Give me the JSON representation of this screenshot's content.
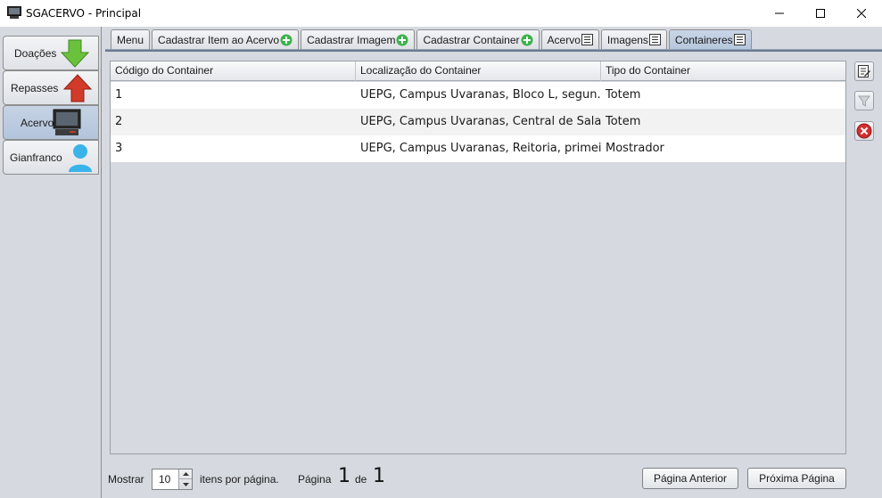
{
  "window": {
    "title": "SGACERVO - Principal"
  },
  "sidebar": {
    "items": [
      {
        "label": "Doações",
        "icon": "arrow-down-green-icon"
      },
      {
        "label": "Repasses",
        "icon": "arrow-up-red-icon"
      },
      {
        "label": "Acervo",
        "icon": "computer-icon",
        "selected": true
      },
      {
        "label": "Gianfranco",
        "icon": "user-icon"
      }
    ]
  },
  "tabs": [
    {
      "label": "Menu",
      "icon": ""
    },
    {
      "label": "Cadastrar Item ao Acervo",
      "icon": "add-icon"
    },
    {
      "label": "Cadastrar Imagem",
      "icon": "add-icon"
    },
    {
      "label": "Cadastrar Container",
      "icon": "add-icon"
    },
    {
      "label": "Acervo",
      "icon": "list-icon"
    },
    {
      "label": "Imagens",
      "icon": "list-icon"
    },
    {
      "label": "Containeres",
      "icon": "list-icon",
      "selected": true
    }
  ],
  "table": {
    "columns": [
      "Código do Container",
      "Localização do Container",
      "Tipo do Container"
    ],
    "rows": [
      [
        "1",
        "UEPG, Campus Uvaranas, Bloco L, segun...",
        "Totem"
      ],
      [
        "2",
        "UEPG, Campus Uvaranas, Central de Salas",
        "Totem"
      ],
      [
        "3",
        "UEPG, Campus Uvaranas, Reitoria, primei...",
        "Mostrador"
      ]
    ]
  },
  "side_actions": [
    {
      "icon": "edit-icon"
    },
    {
      "icon": "filter-icon",
      "disabled": true
    },
    {
      "icon": "delete-icon"
    }
  ],
  "footer": {
    "show_label": "Mostrar",
    "per_page_value": "10",
    "per_page_suffix": "itens por página.",
    "page_label": "Página",
    "current_page": "1",
    "of_label": "de",
    "total_pages": "1",
    "prev_button": "Página Anterior",
    "next_button": "Próxima Página"
  },
  "colors": {
    "background": "#d6d9df",
    "selected_tab": "#b6c6dc",
    "add_green": "#3cb34a",
    "delete_red": "#d32f2f"
  }
}
